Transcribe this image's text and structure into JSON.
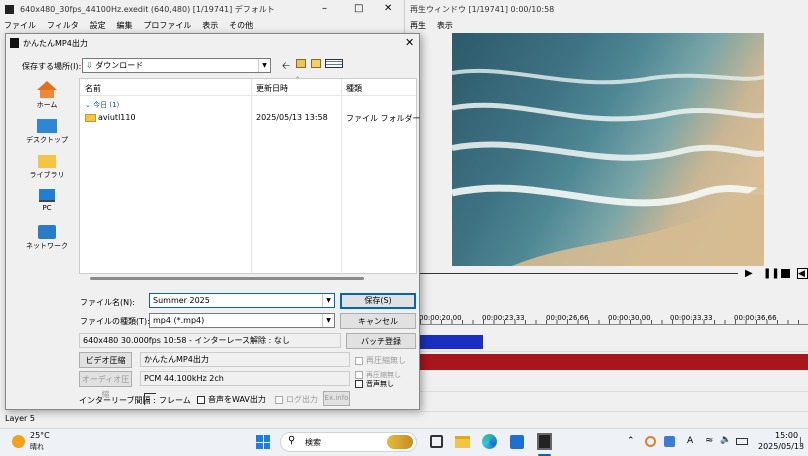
{
  "editor": {
    "title": "640x480_30fps_44100Hz.exedit (640,480)  [1/19741]  デフォルト",
    "menus": [
      "ファイル",
      "フィルタ",
      "設定",
      "編集",
      "プロファイル",
      "表示",
      "その他"
    ],
    "layer_label": "Layer 5"
  },
  "player": {
    "title": "再生ウィンドウ  [1/19741]  0:00/10:58",
    "menus": [
      "再生",
      "表示"
    ]
  },
  "timeline": {
    "ticks": [
      "00:00:20.00",
      "00:00:23.33",
      "00:00:26.66",
      "00:00:30.00",
      "00:00:33.33",
      "00:00:36.66"
    ]
  },
  "dialog": {
    "title": "かんたんMP4出力",
    "save_in_label": "保存する場所(I):",
    "save_in_value": "ダウンロード",
    "places": [
      "ホーム",
      "デスクトップ",
      "ライブラリ",
      "PC",
      "ネットワーク"
    ],
    "columns": [
      "名前",
      "更新日時",
      "種類"
    ],
    "group_label": "今日 (1)",
    "rows": [
      {
        "name": "aviutl110",
        "date": "2025/05/13 13:58",
        "type": "ファイル フォルダー"
      }
    ],
    "filename_label": "ファイル名(N):",
    "filename_value": "Summer 2025",
    "filetype_label": "ファイルの種類(T):",
    "filetype_value": "mp4 (*.mp4)",
    "save_button": "保存(S)",
    "cancel_button": "キャンセル",
    "info_text": "640x480  30.000fps  10:58  -  インターレース解除 : なし",
    "batch_button": "バッチ登録",
    "video_button": "ビデオ圧縮",
    "video_codec": "かんたんMP4出力",
    "video_uncompressed": "再圧縮無し",
    "audio_button": "オーディオ圧縮",
    "audio_codec": "PCM 44.100kHz 2ch",
    "audio_uncompressed": "再圧縮無し",
    "no_audio": "音声無し",
    "interleave_label": "インターリーブ間隔 :",
    "frame_label": "フレーム",
    "wav_label": "音声をWAV出力",
    "log_label": "ログ出力",
    "exinfo_button": "Ex.info"
  },
  "taskbar": {
    "weather_temp": "25°C",
    "weather_desc": "晴れ",
    "search_placeholder": "検索",
    "ime": "A",
    "time": "15:00",
    "date": "2025/05/13"
  },
  "colors": {
    "video_clip": "#1a2fbf",
    "audio_clip": "#a8151a",
    "accent": "#0067c0"
  }
}
